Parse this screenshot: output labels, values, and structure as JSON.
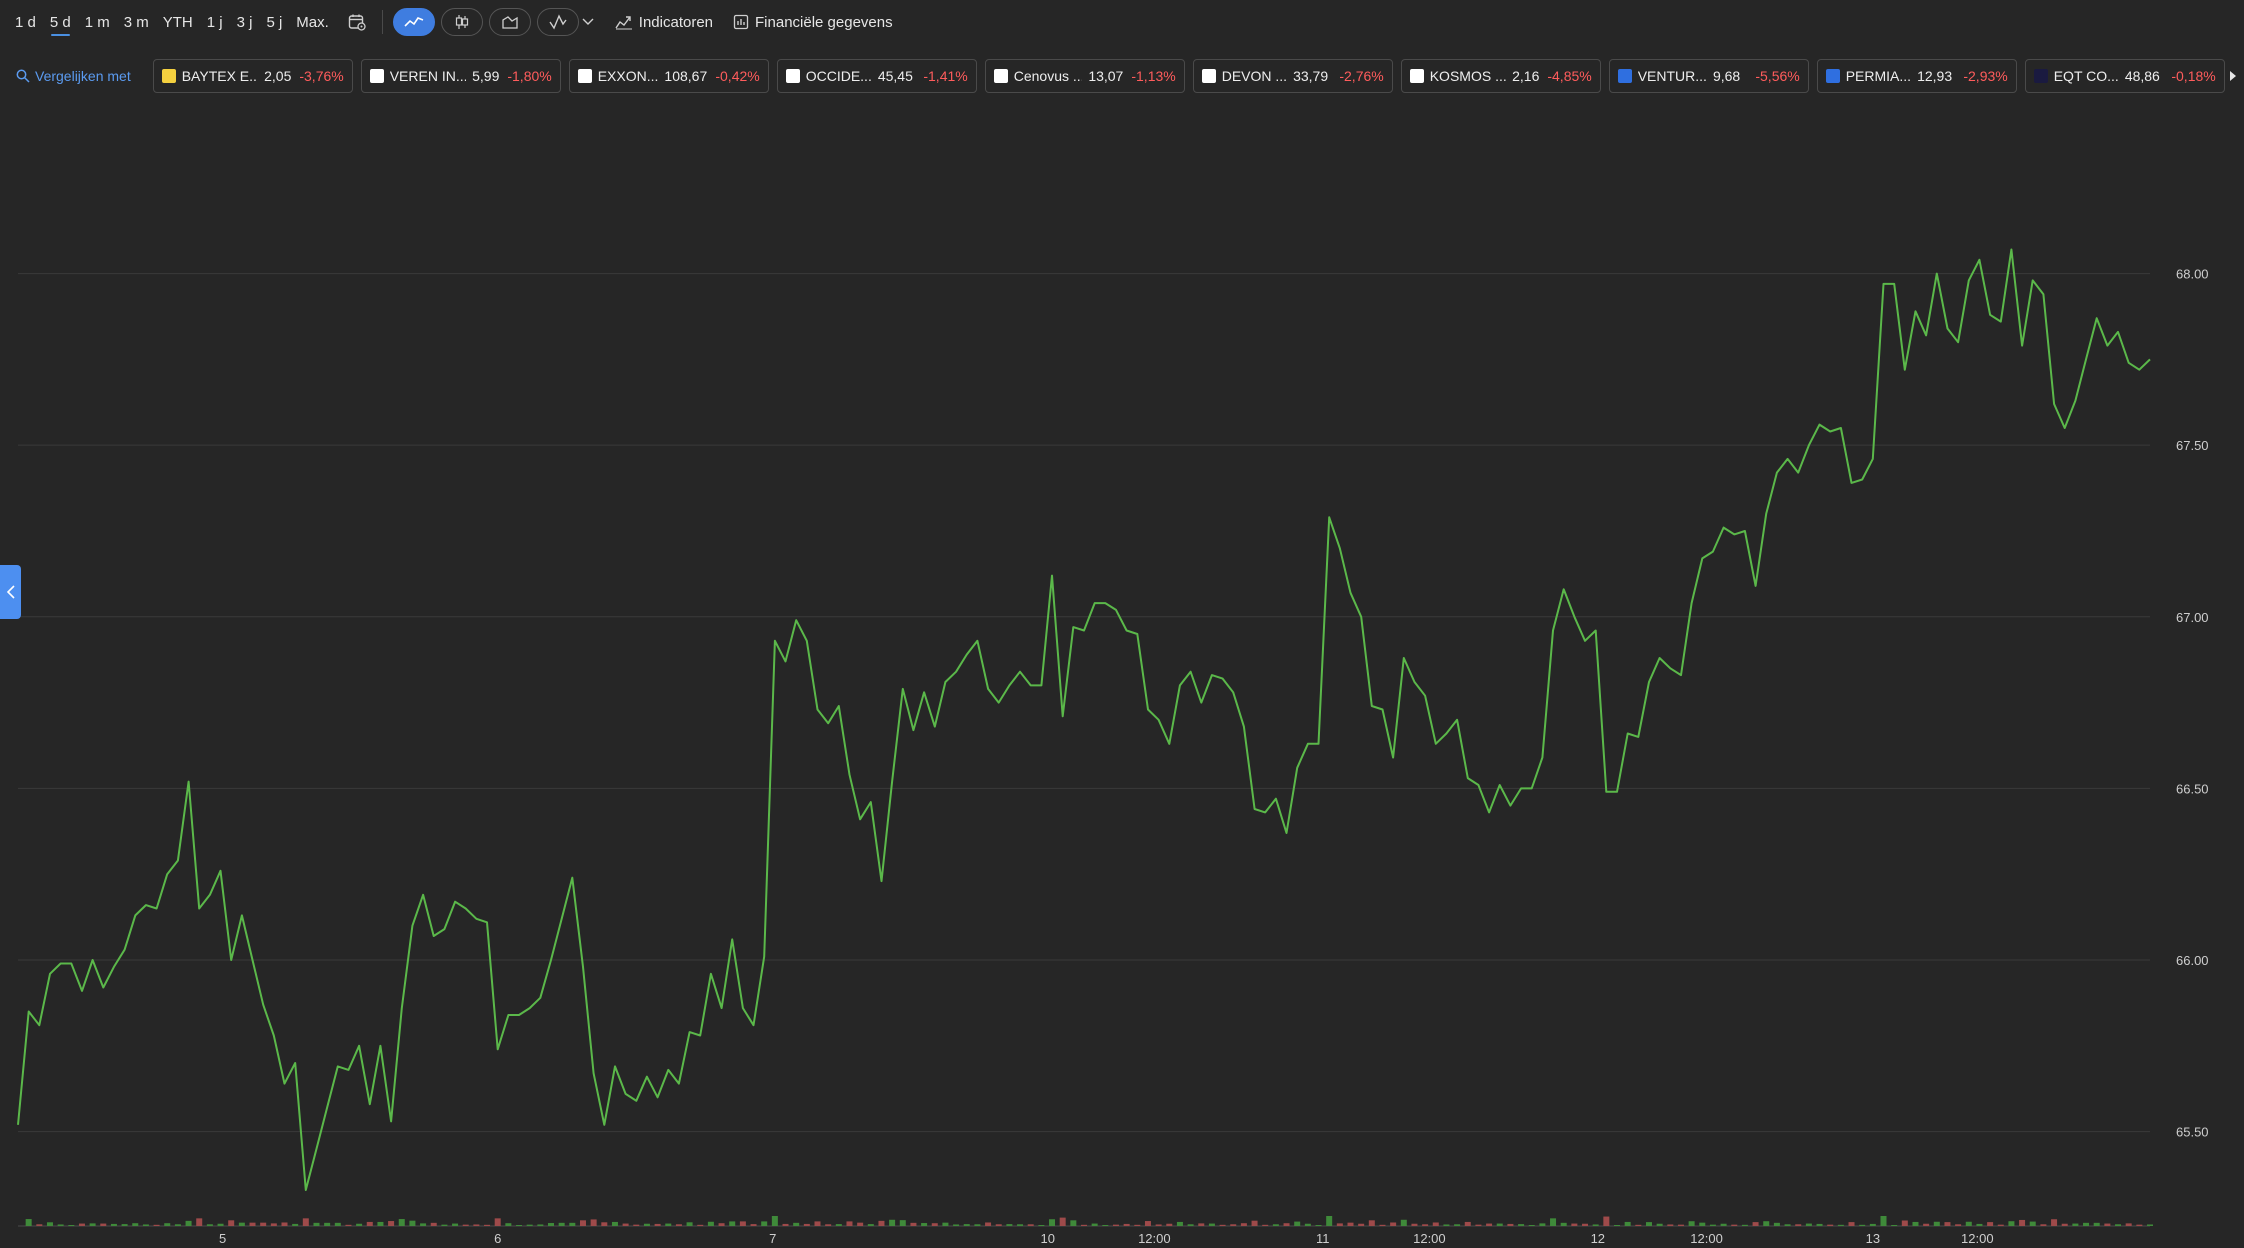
{
  "toolbar": {
    "ranges": [
      {
        "label": "1 d",
        "active": false
      },
      {
        "label": "5 d",
        "active": true
      },
      {
        "label": "1 m",
        "active": false
      },
      {
        "label": "3 m",
        "active": false
      },
      {
        "label": "YTH",
        "active": false
      },
      {
        "label": "1 j",
        "active": false
      },
      {
        "label": "3 j",
        "active": false
      },
      {
        "label": "5 j",
        "active": false
      },
      {
        "label": "Max.",
        "active": false
      }
    ],
    "calendar_icon": "calendar-settings-icon",
    "chart_types": [
      {
        "icon": "line-chart-icon",
        "active": true
      },
      {
        "icon": "candlestick-icon",
        "active": false
      },
      {
        "icon": "area-chart-icon",
        "active": false
      },
      {
        "icon": "draw-icon",
        "active": false
      }
    ],
    "indicators_label": "Indicatoren",
    "financials_label": "Financiële gegevens"
  },
  "compare": {
    "label": "Vergelijken met",
    "chips": [
      {
        "name": "BAYTEX E...",
        "price": "2,05",
        "change": "-3,76%",
        "logo_color": "#f4d03f"
      },
      {
        "name": "VEREN IN...",
        "price": "5,99",
        "change": "-1,80%",
        "logo_color": "#ffffff"
      },
      {
        "name": "EXXON...",
        "price": "108,67",
        "change": "-0,42%",
        "logo_color": "#ffffff"
      },
      {
        "name": "OCCIDE...",
        "price": "45,45",
        "change": "-1,41%",
        "logo_color": "#ffffff"
      },
      {
        "name": "Cenovus ...",
        "price": "13,07",
        "change": "-1,13%",
        "logo_color": "#ffffff"
      },
      {
        "name": "DEVON ...",
        "price": "33,79",
        "change": "-2,76%",
        "logo_color": "#ffffff"
      },
      {
        "name": "KOSMOS ...",
        "price": "2,16",
        "change": "-4,85%",
        "logo_color": "#ffffff"
      },
      {
        "name": "VENTUR...",
        "price": "9,68",
        "change": "-5,56%",
        "logo_color": "#2f6fe0"
      },
      {
        "name": "PERMIA...",
        "price": "12,93",
        "change": "-2,93%",
        "logo_color": "#2f6fe0"
      },
      {
        "name": "EQT CO...",
        "price": "48,86",
        "change": "-0,18%",
        "logo_color": "#1a1a40"
      }
    ]
  },
  "colors": {
    "line": "#5bb84a",
    "grid": "#3a3a3a",
    "vol_up": "#3f8a3a",
    "vol_down": "#9e4a4a"
  },
  "chart_data": {
    "type": "line",
    "title": "",
    "xlabel": "",
    "ylabel": "",
    "ylim": [
      65.33,
      68.36
    ],
    "yticks": [
      "68.00",
      "67.50",
      "67.00",
      "66.50",
      "66.00",
      "65.50"
    ],
    "ytick_values": [
      68.0,
      67.5,
      67.0,
      66.5,
      66.0,
      65.5
    ],
    "xticks": [
      {
        "label": "5",
        "t": 0.096
      },
      {
        "label": "6",
        "t": 0.225
      },
      {
        "label": "7",
        "t": 0.354
      },
      {
        "label": "10",
        "t": 0.483
      },
      {
        "label": "12:00",
        "t": 0.533
      },
      {
        "label": "11",
        "t": 0.612
      },
      {
        "label": "12:00",
        "t": 0.662
      },
      {
        "label": "12",
        "t": 0.741
      },
      {
        "label": "12:00",
        "t": 0.792
      },
      {
        "label": "13",
        "t": 0.87
      },
      {
        "label": "12:00",
        "t": 0.919
      }
    ],
    "grid": true,
    "values": [
      65.52,
      65.85,
      65.81,
      65.96,
      65.99,
      65.99,
      65.91,
      66.0,
      65.92,
      65.98,
      66.03,
      66.13,
      66.16,
      66.15,
      66.25,
      66.29,
      66.52,
      66.15,
      66.19,
      66.26,
      66.0,
      66.13,
      66.0,
      65.87,
      65.78,
      65.64,
      65.7,
      65.33,
      65.45,
      65.57,
      65.69,
      65.68,
      65.75,
      65.58,
      65.75,
      65.53,
      65.86,
      66.1,
      66.19,
      66.07,
      66.09,
      66.17,
      66.15,
      66.12,
      66.11,
      65.74,
      65.84,
      65.84,
      65.86,
      65.89,
      66.0,
      66.12,
      66.24,
      65.98,
      65.67,
      65.52,
      65.69,
      65.61,
      65.59,
      65.66,
      65.6,
      65.68,
      65.64,
      65.79,
      65.78,
      65.96,
      65.86,
      66.06,
      65.86,
      65.81,
      66.01,
      66.93,
      66.87,
      66.99,
      66.93,
      66.73,
      66.69,
      66.74,
      66.54,
      66.41,
      66.46,
      66.23,
      66.52,
      66.79,
      66.67,
      66.78,
      66.68,
      66.81,
      66.84,
      66.89,
      66.93,
      66.79,
      66.75,
      66.8,
      66.84,
      66.8,
      66.8,
      67.12,
      66.71,
      66.97,
      66.96,
      67.04,
      67.04,
      67.02,
      66.96,
      66.95,
      66.73,
      66.7,
      66.63,
      66.8,
      66.84,
      66.75,
      66.83,
      66.82,
      66.78,
      66.68,
      66.44,
      66.43,
      66.47,
      66.37,
      66.56,
      66.63,
      66.63,
      67.29,
      67.2,
      67.07,
      67.0,
      66.74,
      66.73,
      66.59,
      66.88,
      66.81,
      66.77,
      66.63,
      66.66,
      66.7,
      66.53,
      66.51,
      66.43,
      66.51,
      66.45,
      66.5,
      66.5,
      66.59,
      66.96,
      67.08,
      67.0,
      66.93,
      66.96,
      66.49,
      66.49,
      66.66,
      66.65,
      66.81,
      66.88,
      66.85,
      66.83,
      67.04,
      67.17,
      67.19,
      67.26,
      67.24,
      67.25,
      67.09,
      67.3,
      67.42,
      67.46,
      67.42,
      67.5,
      67.56,
      67.54,
      67.55,
      67.39,
      67.4,
      67.46,
      67.97,
      67.97,
      67.72,
      67.89,
      67.82,
      68.0,
      67.84,
      67.8,
      67.98,
      68.04,
      67.88,
      67.86,
      68.07,
      67.79,
      67.98,
      67.94,
      67.62,
      67.55,
      67.63,
      67.75,
      67.87,
      67.79,
      67.83,
      67.74,
      67.72,
      67.75
    ]
  }
}
